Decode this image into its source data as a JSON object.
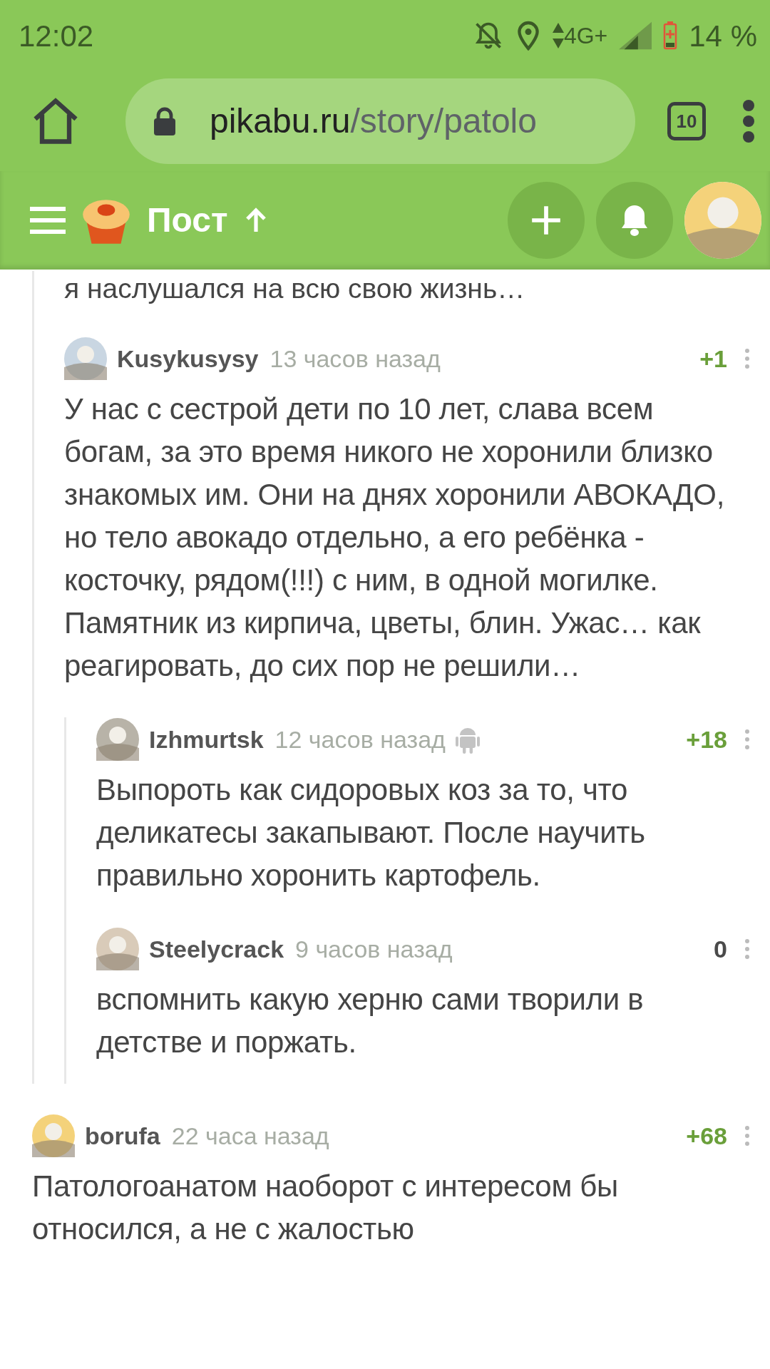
{
  "status_bar": {
    "time": "12:02",
    "network": "4G+",
    "battery": "14 %",
    "charging": true
  },
  "browser": {
    "url_host": "pikabu.ru",
    "url_path": "/story/patolo",
    "tab_count": "10"
  },
  "header": {
    "title": "Пост"
  },
  "comments": [
    {
      "kind": "cut",
      "children": [
        {
          "kind": "cut",
          "text": "я наслушался на всю свою жизнь…"
        },
        {
          "kind": "full",
          "author": "Kusykusysy",
          "time": "13 часов назад",
          "score": "+1",
          "color": "#6a9f3a",
          "from_mobile": false,
          "text": "У нас с сестрой дети по 10 лет, слава всем богам, за это время никого не хоронили близко знакомых им. Они на днях хоронили АВОКАДО, но тело авокадо отдельно, а его ребёнка - косточку, рядом(!!!) с ним, в одной могилке. Памятник из кирпича, цветы, блин. Ужас… как реагировать, до сих пор не решили…",
          "children": [
            {
              "kind": "full",
              "author": "Izhmurtsk",
              "time": "12 часов назад",
              "score": "+18",
              "color": "#6a9f3a",
              "from_mobile": true,
              "text": "Выпороть как сидоровых коз за то, что деликатесы закапывают. После научить правильно хоронить картофель."
            },
            {
              "kind": "full",
              "author": "Steelycrack",
              "time": "9 часов назад",
              "score": "0",
              "color": "#4a4a4a",
              "from_mobile": false,
              "text": "вспомнить какую херню сами творили в детстве и поржать."
            }
          ]
        }
      ]
    },
    {
      "kind": "full",
      "author": "borufa",
      "time": "22 часа назад",
      "score": "+68",
      "color": "#6a9f3a",
      "from_mobile": false,
      "text": "Патологоанатом наоборот с интересом бы относился, а не с жалостью"
    }
  ]
}
